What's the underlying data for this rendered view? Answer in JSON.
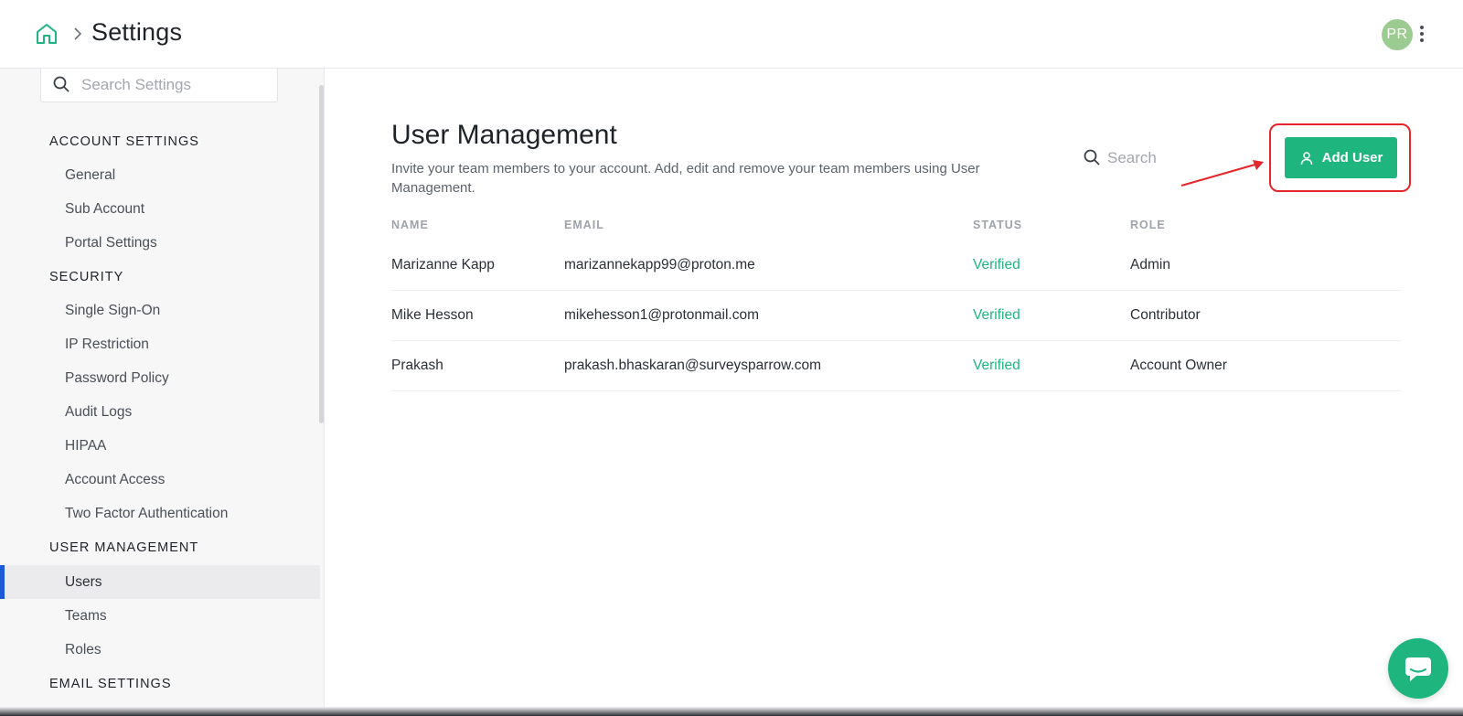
{
  "header": {
    "title": "Settings",
    "avatar_initials": "PR"
  },
  "sidebar": {
    "search_placeholder": "Search Settings",
    "sections": [
      {
        "label": "ACCOUNT SETTINGS",
        "items": [
          "General",
          "Sub Account",
          "Portal Settings"
        ]
      },
      {
        "label": "SECURITY",
        "items": [
          "Single Sign-On",
          "IP Restriction",
          "Password Policy",
          "Audit Logs",
          "HIPAA",
          "Account Access",
          "Two Factor Authentication"
        ]
      },
      {
        "label": "USER MANAGEMENT",
        "items": [
          "Users",
          "Teams",
          "Roles"
        ]
      },
      {
        "label": "EMAIL SETTINGS",
        "items": []
      }
    ],
    "active_item": "Users"
  },
  "main": {
    "title": "User Management",
    "description": "Invite your team members to your account. Add, edit and remove your team members using User Management.",
    "search_placeholder": "Search",
    "add_user_label": "Add User",
    "table": {
      "columns": [
        "NAME",
        "EMAIL",
        "STATUS",
        "ROLE"
      ],
      "rows": [
        {
          "name": "Marizanne Kapp",
          "email": "marizannekapp99@proton.me",
          "status": "Verified",
          "role": "Admin"
        },
        {
          "name": "Mike Hesson",
          "email": "mikehesson1@protonmail.com",
          "status": "Verified",
          "role": "Contributor"
        },
        {
          "name": "Prakash",
          "email": "prakash.bhaskaran@surveysparrow.com",
          "status": "Verified",
          "role": "Account Owner"
        }
      ]
    }
  },
  "colors": {
    "accent_green": "#1fb57f",
    "active_indicator": "#1b5bd8",
    "annotation_red": "#e5262a",
    "avatar": "#9ccb91"
  },
  "icons": [
    "home-icon",
    "chevron-right-icon",
    "kebab-menu-icon",
    "search-icon",
    "user-icon",
    "chat-icon"
  ]
}
